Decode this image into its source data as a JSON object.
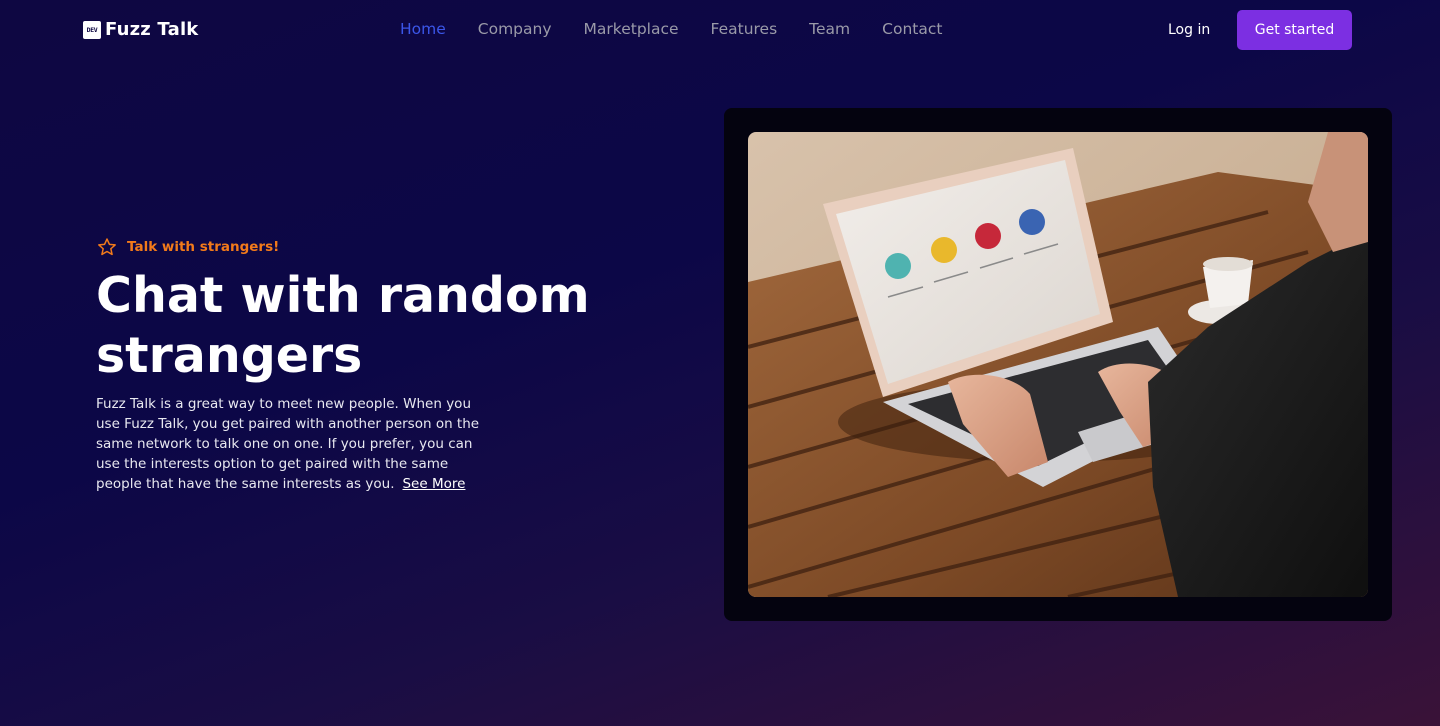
{
  "brand": {
    "badge": "DEV",
    "name": "Fuzz Talk"
  },
  "nav": {
    "links": [
      {
        "label": "Home",
        "active": true
      },
      {
        "label": "Company"
      },
      {
        "label": "Marketplace"
      },
      {
        "label": "Features"
      },
      {
        "label": "Team"
      },
      {
        "label": "Contact"
      }
    ],
    "login": "Log in",
    "cta": "Get started"
  },
  "hero": {
    "tagline_icon": "star-icon",
    "tagline": "Talk with strangers!",
    "headline": "Chat with random strangers",
    "description": "Fuzz Talk is a great way to meet new people. When you use Fuzz Talk, you get paired with another person on the same network to talk one on one. If you prefer, you can use the interests option to get paired with the same people that have the same interests as you.",
    "see_more": "See More"
  },
  "colors": {
    "background_start": "#0e0742",
    "background_end": "#3a1238",
    "accent_blue": "#3b56e8",
    "accent_orange": "#f27a1a",
    "cta_purple": "#7c2fe2"
  }
}
